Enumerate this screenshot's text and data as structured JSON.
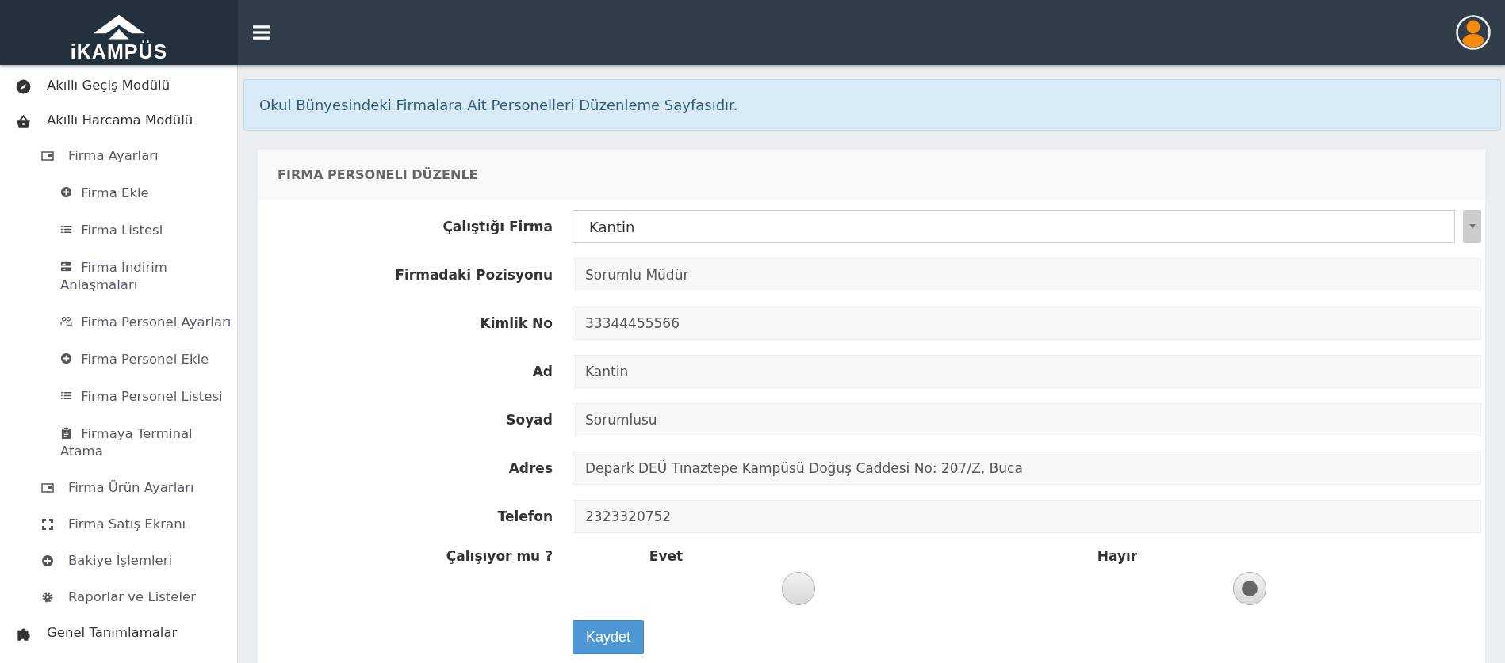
{
  "header": {
    "logo_text": "iKAMPÜS"
  },
  "sidebar": {
    "items": [
      {
        "label": "Akıllı Geçiş Modülü",
        "kind": "compass"
      },
      {
        "label": "Akıllı Harcama Modülü",
        "kind": "basket",
        "children": [
          {
            "label": "Firma Ayarları",
            "kind": "window",
            "children": [
              {
                "label": "Firma Ekle",
                "kind": "plus"
              },
              {
                "label": "Firma Listesi",
                "kind": "list"
              },
              {
                "label": "Firma İndirim Anlaşmaları",
                "kind": "server"
              },
              {
                "label": "Firma Personel Ayarları",
                "kind": "people"
              },
              {
                "label": "Firma Personel Ekle",
                "kind": "plus"
              },
              {
                "label": "Firma Personel Listesi",
                "kind": "list"
              },
              {
                "label": "Firmaya Terminal Atama",
                "kind": "clipboard"
              }
            ]
          },
          {
            "label": "Firma Ürün Ayarları",
            "kind": "window"
          },
          {
            "label": "Firma Satış Ekranı",
            "kind": "expand"
          },
          {
            "label": "Bakiye İşlemleri",
            "kind": "plus"
          },
          {
            "label": "Raporlar ve Listeler",
            "kind": "gear"
          }
        ]
      },
      {
        "label": "Genel Tanımlamalar",
        "kind": "puzzle"
      }
    ]
  },
  "info_alert": "Okul Bünyesindeki Firmalara Ait Personelleri Düzenleme Sayfasıdır.",
  "form": {
    "title": "FIRMA PERSONELI DÜZENLE",
    "fields": [
      {
        "label": "Çalıştığı Firma",
        "kind": "select",
        "value": "Kantin"
      },
      {
        "label": "Firmadaki Pozisyonu",
        "kind": "text",
        "value": "Sorumlu Müdür"
      },
      {
        "label": "Kimlik No",
        "kind": "text",
        "value": "33344455566"
      },
      {
        "label": "Ad",
        "kind": "text",
        "value": "Kantin"
      },
      {
        "label": "Soyad",
        "kind": "text",
        "value": "Sorumlusu"
      },
      {
        "label": "Adres",
        "kind": "text",
        "value": "Depark DEÜ Tınaztepe Kampüsü Doğuş Caddesi No: 207/Z, Buca"
      },
      {
        "label": "Telefon",
        "kind": "text",
        "value": "2323320752"
      }
    ],
    "working": {
      "label": "Çalışıyor mu ?",
      "options": [
        {
          "label": "Evet",
          "selected": false
        },
        {
          "label": "Hayır",
          "selected": true
        }
      ]
    },
    "submit": "Kaydet"
  }
}
